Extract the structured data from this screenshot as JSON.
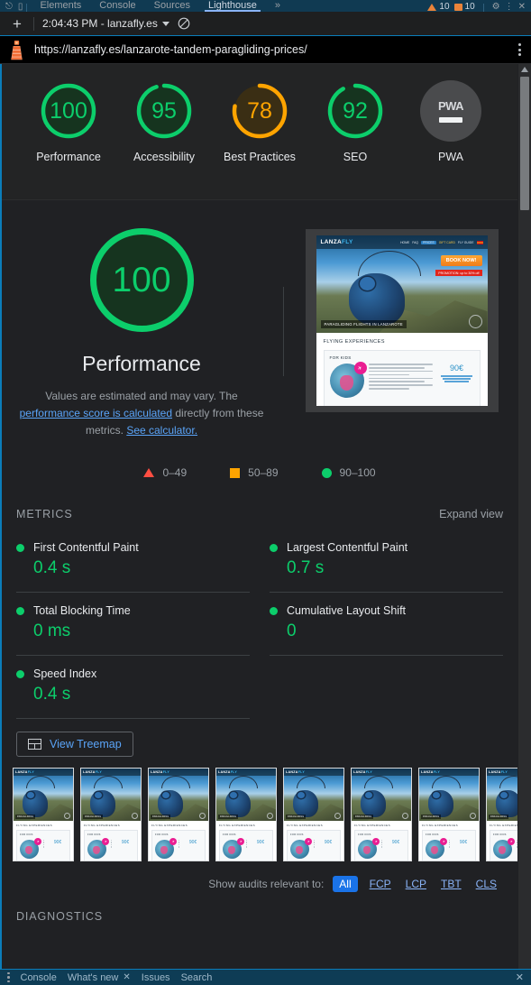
{
  "devtools": {
    "tabs": [
      {
        "label": "Elements",
        "active": false
      },
      {
        "label": "Console",
        "active": false
      },
      {
        "label": "Sources",
        "active": false
      },
      {
        "label": "Lighthouse",
        "active": true
      }
    ],
    "more_tabs_label": "»",
    "warning_count": "10",
    "error_count": "10",
    "gear_icon": "gear-icon",
    "settings_icon": "more-vertical-icon",
    "close_icon": "close-icon",
    "inspect_icon": "inspect-icon",
    "device_icon": "device-toolbar-icon"
  },
  "toolbar": {
    "new_report_label": "+",
    "report_name": "2:04:43 PM - lanzafly.es",
    "clear_icon": "clear-icon",
    "dropdown_icon": "chevron-down-icon"
  },
  "url_bar": {
    "lighthouse_icon": "lighthouse-icon",
    "url": "https://lanzafly.es/lanzarote-tandem-paragliding-prices/",
    "menu_icon": "kebab-menu-icon"
  },
  "gauges": [
    {
      "label": "Performance",
      "score": "100",
      "value": 100,
      "color": "#0cce6b",
      "track": "#16341f"
    },
    {
      "label": "Accessibility",
      "score": "95",
      "value": 95,
      "color": "#0cce6b",
      "track": "#16341f"
    },
    {
      "label": "Best Practices",
      "score": "78",
      "value": 78,
      "color": "#ffa400",
      "track": "#3a2e14"
    },
    {
      "label": "SEO",
      "score": "92",
      "value": 92,
      "color": "#0cce6b",
      "track": "#16341f"
    },
    {
      "label": "PWA",
      "score": "",
      "value": 0,
      "color": "#4a4b4d",
      "track": "#4a4b4d",
      "badge_text": "PWA"
    }
  ],
  "category": {
    "score": "100",
    "title": "Performance",
    "desc_part1": "Values are estimated and may vary. The ",
    "desc_link1": "performance score is calculated",
    "desc_part2": " directly from these metrics. ",
    "desc_link2": "See calculator."
  },
  "legend": [
    {
      "shape": "triangle",
      "range": "0–49",
      "color": "#ff4e42"
    },
    {
      "shape": "square",
      "range": "50–89",
      "color": "#ffa400"
    },
    {
      "shape": "circle",
      "range": "90–100",
      "color": "#0cce6b"
    }
  ],
  "metrics_section": {
    "title": "METRICS",
    "expand_label": "Expand view",
    "items": [
      {
        "name": "First Contentful Paint",
        "value": "0.4 s",
        "status": "pass"
      },
      {
        "name": "Largest Contentful Paint",
        "value": "0.7 s",
        "status": "pass"
      },
      {
        "name": "Total Blocking Time",
        "value": "0 ms",
        "status": "pass"
      },
      {
        "name": "Cumulative Layout Shift",
        "value": "0",
        "status": "pass"
      },
      {
        "name": "Speed Index",
        "value": "0.4 s",
        "status": "pass"
      }
    ]
  },
  "treemap": {
    "button_label": "View Treemap",
    "icon": "treemap-icon"
  },
  "site_preview": {
    "logo_main": "LANZA",
    "logo_accent": "FLY",
    "nav_items": [
      "HOME",
      "FAQ",
      "PRICES",
      "GIFT CARD",
      "FLY GUIDE"
    ],
    "book_now": "BOOK NOW!",
    "promo": "PROMOTION: up to 30% off",
    "hero_caption": "PARAGLIDING FLIGHTS IN LANZAROTE",
    "section_title": "FLYING EXPERIENCES",
    "card_title": "FOR KIDS",
    "price": "90€"
  },
  "audit_filter": {
    "label": "Show audits relevant to:",
    "options": [
      {
        "label": "All",
        "active": true
      },
      {
        "label": "FCP",
        "active": false
      },
      {
        "label": "LCP",
        "active": false
      },
      {
        "label": "TBT",
        "active": false
      },
      {
        "label": "CLS",
        "active": false
      }
    ]
  },
  "diagnostics": {
    "title": "DIAGNOSTICS"
  },
  "drawer": {
    "tabs": [
      {
        "label": "Console",
        "closable": false
      },
      {
        "label": "What's new",
        "closable": true
      },
      {
        "label": "Issues",
        "closable": false
      },
      {
        "label": "Search",
        "closable": false
      }
    ],
    "close_icon": "close-icon"
  },
  "filmstrip_frames": 8,
  "colors": {
    "pass": "#0cce6b",
    "average": "#ffa400",
    "fail": "#ff4e42",
    "link": "#5aa4f8",
    "accent": "#1a73e8",
    "background": "#202124"
  }
}
